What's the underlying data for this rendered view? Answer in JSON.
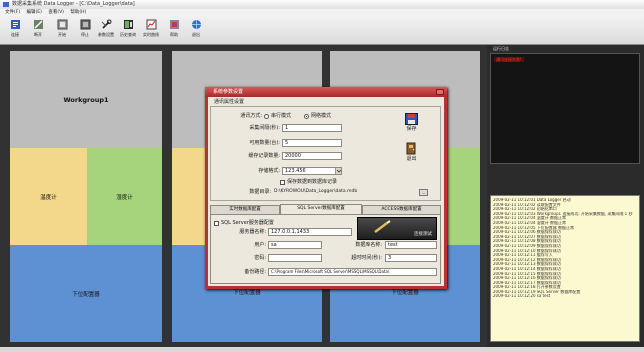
{
  "window": {
    "title": "数据采集系统 Data Logger - [C:\\Data_Logger\\data]",
    "menu": [
      "文件(F)",
      "编辑(E)",
      "查看(V)",
      "帮助(H)"
    ]
  },
  "toolbar": {
    "buttons": [
      {
        "label": "连接",
        "icon": "connect-icon"
      },
      {
        "label": "断开",
        "icon": "disconnect-icon"
      },
      {
        "label": "开始",
        "icon": "start-icon"
      },
      {
        "label": "停止",
        "icon": "stop-icon"
      },
      {
        "label": "参数设置",
        "icon": "settings-icon"
      },
      {
        "label": "历史查询",
        "icon": "query-icon"
      },
      {
        "label": "实时曲线",
        "icon": "curve-icon"
      },
      {
        "label": "帮助",
        "icon": "help-icon"
      },
      {
        "label": "退出",
        "icon": "exit-icon"
      }
    ]
  },
  "workgroups": [
    {
      "title": "Workgroup1",
      "left_label": "温度计",
      "right_label": "湿度计",
      "bottom_label": "下位配置器"
    },
    {
      "bottom_label": "下位配置器"
    },
    {
      "bottom_label": "下位配置器"
    }
  ],
  "log_panel": {
    "title": "运行日志",
    "alert": "通讯连接失败!",
    "lines": [
      "2009-02-11 10:12:01 Data Logger 启动",
      "2009-02-11 10:12:02 读取配置文件",
      "2009-02-11 10:12:02 初始化串口",
      "2009-02-11 10:12:03 Workgroup1 连接成功, 开始采集数据, 采集间隔 1 秒",
      "2009-02-11 10:12:04 温度计 数据正常",
      "2009-02-11 10:12:04 湿度计 数据正常",
      "2009-02-11 10:12:05 下位配置器 数据正常",
      "2009-02-11 10:12:06 数据保存成功",
      "2009-02-11 10:12:07 数据保存成功",
      "2009-02-11 10:12:08 数据保存成功",
      "2009-02-11 10:12:09 数据保存成功",
      "2009-02-11 10:12:10 数据保存成功",
      "2009-02-11 10:12:11 缓存写入",
      "2009-02-11 10:12:12 数据保存成功",
      "2009-02-11 10:12:13 数据保存成功",
      "2009-02-11 10:12:14 数据保存成功",
      "2009-02-11 10:12:15 数据保存成功",
      "2009-02-11 10:12:16 数据保存成功",
      "2009-02-11 10:12:17 数据保存成功",
      "2009-02-11 10:12:18 打开参数设置",
      "2009-02-11 10:12:19 SQL Server 数据库配置",
      "2009-02-11 10:12:20 sa test"
    ]
  },
  "dialog": {
    "title": "系统参数设置",
    "group_title": "通讯属性设置",
    "comm_mode_label": "通讯方式:",
    "comm_mode_options": [
      "串行模式",
      "网络模式"
    ],
    "comm_mode_selected": "网络模式",
    "fields": [
      {
        "label": "采集间隔(秒):",
        "value": "1"
      },
      {
        "label": "可用数量(台):",
        "value": "5"
      },
      {
        "label": "缓存记录数量:",
        "value": "20000"
      },
      {
        "label": "存储格式:",
        "value": "123.456"
      }
    ],
    "save_to_db_label": "保存数据到数据库记录",
    "data_dir_label": "数据目录:",
    "data_dir_value": "D:\\KYROWOU\\Data_Logger\\data.mdb",
    "browse_label": "...",
    "save_label": "保存",
    "exit_label": "退出",
    "tabs": [
      "实时数据库配置",
      "SQL Server数据库配置",
      "ACCESS数据库配置"
    ],
    "active_tab": "SQL Server数据库配置",
    "sql": {
      "enable_label": "SQL Server服务器配置",
      "server_label": "服务器名称:",
      "server_value": "127.0.0.1,1433",
      "user_label": "用户:",
      "user_value": "sa",
      "db_label": "数据库名称:",
      "db_value": "test",
      "password_label": "密码:",
      "password_value": "",
      "timeout_label": "超时时间(秒):",
      "timeout_value": "3",
      "backup_label": "备份路径:",
      "backup_value": "C:\\Program Files\\Microsoft SQL Server\\MSSQL\\MSSQL\\Data\\",
      "connect_label": "连接测试"
    }
  },
  "colors": {
    "panel_gray": "#bdbdbd",
    "panel_yellow": "#f3d88b",
    "panel_green": "#a6d47c",
    "panel_blue": "#5e90d4",
    "dialog_frame": "#b83232",
    "log_background": "#fbf9cf",
    "alert_text": "#ff3a3a"
  }
}
